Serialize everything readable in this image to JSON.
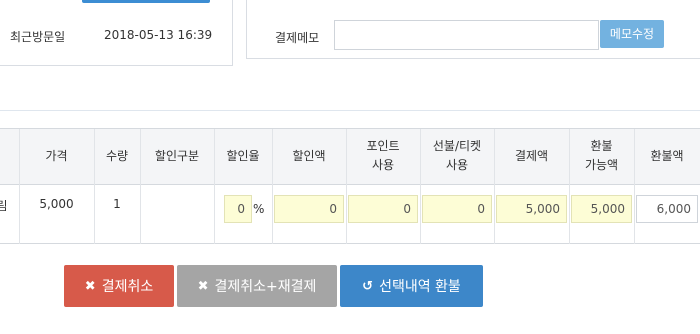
{
  "visit": {
    "label": "최근방문일",
    "value": "2018-05-13 16:39"
  },
  "memo": {
    "label": "결제메모",
    "value": "",
    "button": "메모수정"
  },
  "table": {
    "headers": {
      "price": "가격",
      "qty": "수량",
      "discount_type": "할인구분",
      "discount_rate": "할인율",
      "discount_amount": "할인액",
      "point_line1": "포인트",
      "point_line2": "사용",
      "prepaid_line1": "선불/티켓",
      "prepaid_line2": "사용",
      "payment": "결제액",
      "refundable_line1": "환불",
      "refundable_line2": "가능액",
      "refund": "환불액"
    },
    "row": {
      "name_fragment": "림",
      "price": "5,000",
      "qty": "1",
      "discount_type": "",
      "discount_rate": "0",
      "percent": "%",
      "discount_amount": "0",
      "point": "0",
      "prepaid": "0",
      "payment": "5,000",
      "refundable": "5,000",
      "refund": "6,000"
    }
  },
  "buttons": {
    "cancel": "결제취소",
    "cancel_repay": "결제취소+재결제",
    "refund_selected": "선택내역 환불"
  },
  "icons": {
    "cancel": "times-icon",
    "cancel_repay": "times-icon",
    "refund_selected": "undo-icon"
  },
  "colors": {
    "accent_blue": "#3d87c9",
    "danger_red": "#d75a4a",
    "neutral_gray": "#a5a5a5",
    "memo_button": "#73b2e0",
    "readonly_field": "#fdfdd6"
  }
}
